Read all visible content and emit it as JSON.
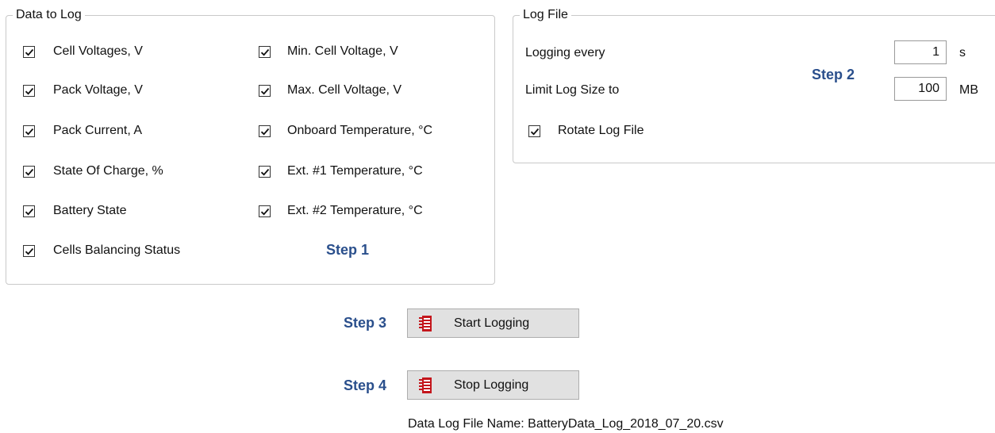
{
  "data_group": {
    "title": "Data to Log",
    "left_items": [
      {
        "label": "Cell Voltages, V",
        "checked": true
      },
      {
        "label": "Pack Voltage, V",
        "checked": true
      },
      {
        "label": "Pack Current, A",
        "checked": true
      },
      {
        "label": "State Of Charge, %",
        "checked": true
      },
      {
        "label": "Battery State",
        "checked": true
      },
      {
        "label": "Cells Balancing Status",
        "checked": true
      }
    ],
    "right_items": [
      {
        "label": "Min. Cell Voltage, V",
        "checked": true
      },
      {
        "label": "Max. Cell Voltage, V",
        "checked": true
      },
      {
        "label": "Onboard Temperature, °C",
        "checked": true
      },
      {
        "label": "Ext. #1 Temperature, °C",
        "checked": true
      },
      {
        "label": "Ext. #2 Temperature, °C",
        "checked": true
      }
    ],
    "step_label": "Step 1"
  },
  "log_file": {
    "title": "Log File",
    "logging_every_label": "Logging every",
    "logging_every_value": "1",
    "logging_every_unit": "s",
    "limit_label": "Limit Log Size to",
    "limit_value": "100",
    "limit_unit": "MB",
    "rotate_label": "Rotate Log File",
    "rotate_checked": true,
    "step_label": "Step 2"
  },
  "actions": {
    "step3_label": "Step 3",
    "start_label": "Start Logging",
    "step4_label": "Step 4",
    "stop_label": "Stop Logging",
    "file_name_text": "Data Log File Name: BatteryData_Log_2018_07_20.csv"
  },
  "colors": {
    "step_text": "#2a4f8c",
    "button_icon": "#c4161c",
    "button_bg": "#e1e1e1"
  },
  "icons": {
    "checkbox": "checkmark-icon",
    "button": "log-book-icon"
  }
}
